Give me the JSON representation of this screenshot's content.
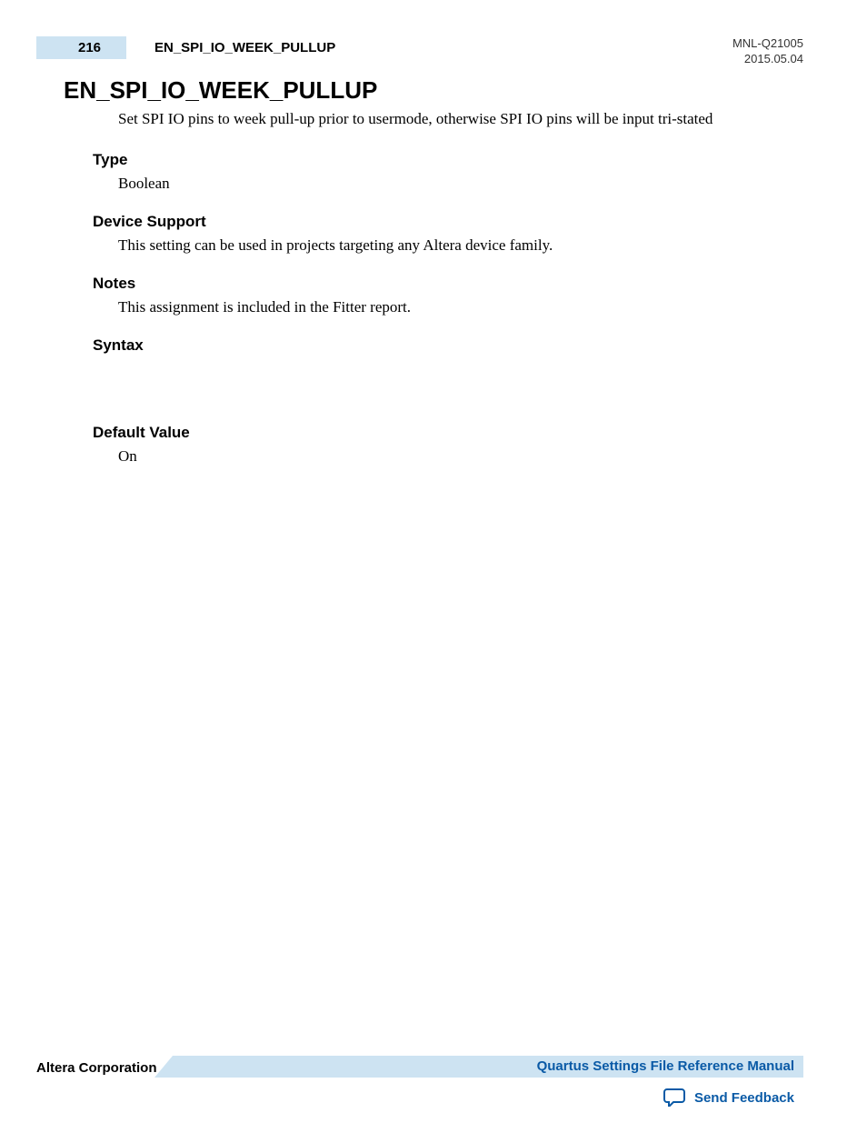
{
  "header": {
    "page_number": "216",
    "running_title": "EN_SPI_IO_WEEK_PULLUP",
    "doc_id": "MNL-Q21005",
    "date": "2015.05.04"
  },
  "title": "EN_SPI_IO_WEEK_PULLUP",
  "intro": "Set SPI IO pins to week pull-up prior to usermode, otherwise SPI IO pins will be input tri-stated",
  "sections": {
    "type_label": "Type",
    "type_body": "Boolean",
    "device_support_label": "Device Support",
    "device_support_body": "This setting can be used in projects targeting any Altera device family.",
    "notes_label": "Notes",
    "notes_body": "This assignment is included in the Fitter report.",
    "syntax_label": "Syntax",
    "default_value_label": "Default Value",
    "default_value_body": "On"
  },
  "footer": {
    "company": "Altera Corporation",
    "manual_link": "Quartus Settings File Reference Manual",
    "feedback_link": "Send Feedback"
  }
}
